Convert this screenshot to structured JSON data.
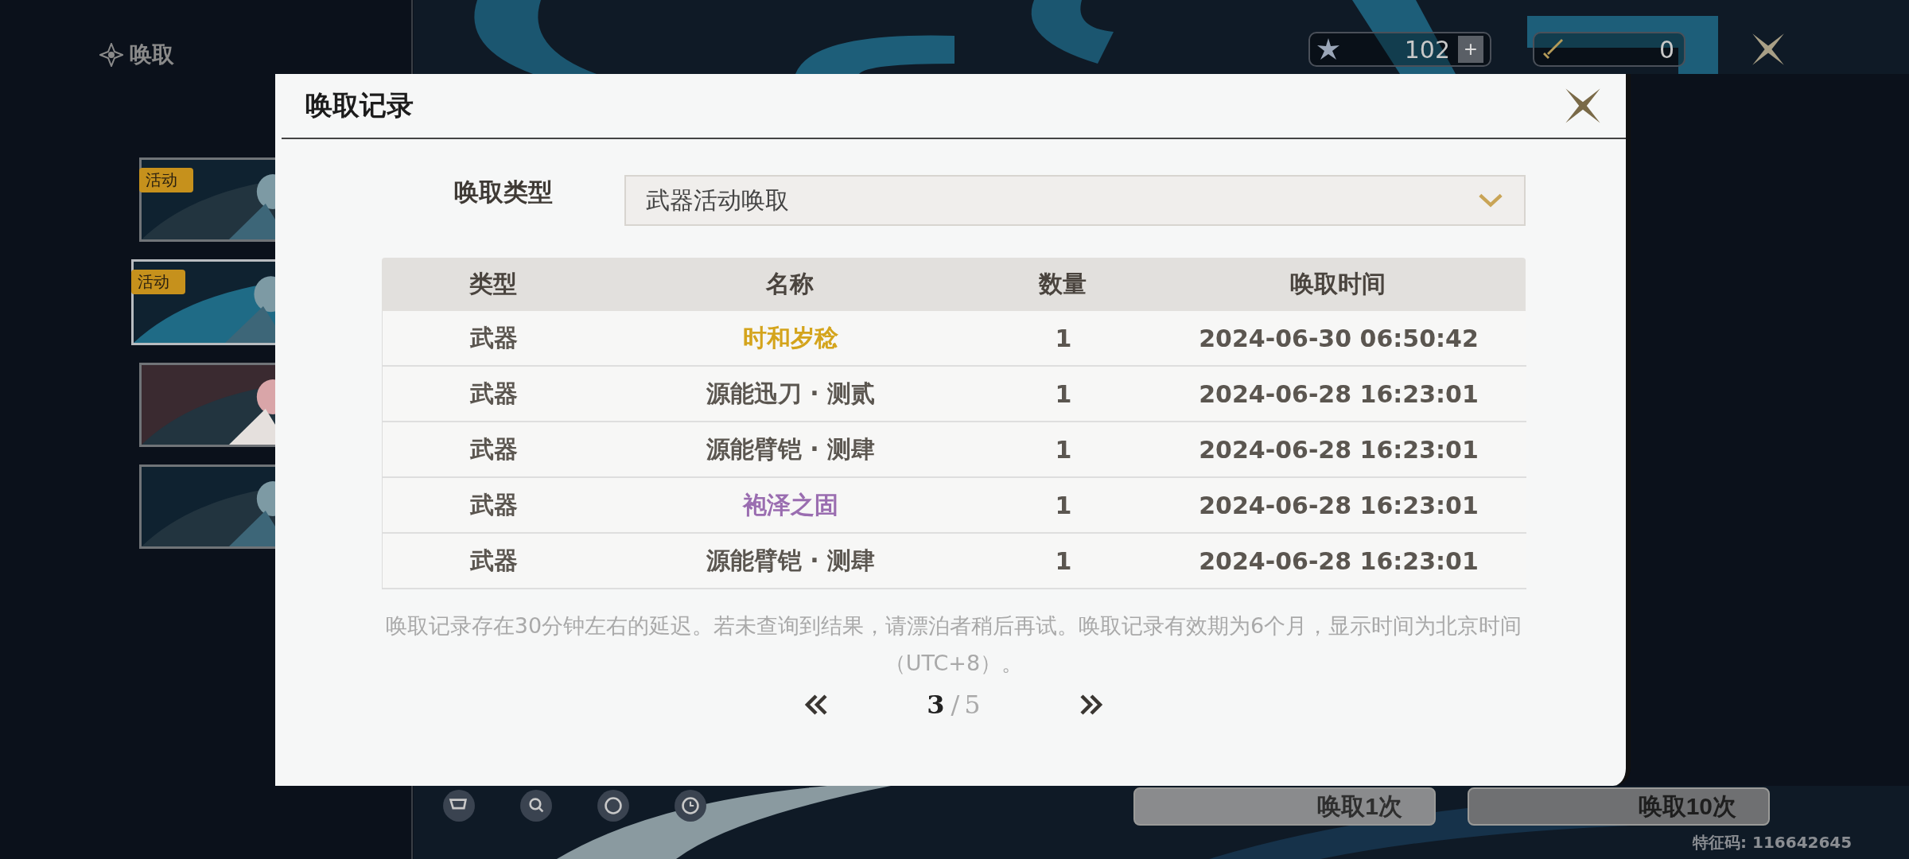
{
  "sidebar": {
    "title": "唤取",
    "banners": [
      {
        "tag": "活动",
        "selected": false
      },
      {
        "tag": "活动",
        "selected": true
      },
      {
        "selected": false
      },
      {
        "selected": false
      }
    ]
  },
  "currencies": [
    {
      "kind": "star",
      "amount": "102",
      "add": "+"
    },
    {
      "kind": "sword",
      "amount": "0"
    }
  ],
  "bottom_buttons": [
    {
      "label": "唤取1次",
      "dim": true
    },
    {
      "label": "唤取10次",
      "dim": false
    }
  ],
  "feature_code": "特征码: 116642645",
  "dialog": {
    "title": "唤取记录",
    "filter": {
      "label": "唤取类型",
      "value": "武器活动唤取"
    },
    "table": {
      "columns": [
        "类型",
        "名称",
        "数量",
        "唤取时间"
      ],
      "rows": [
        {
          "type": "武器",
          "name": "时和岁稔",
          "color": "#d4a41c",
          "count": "1",
          "time": "2024-06-30 06:50:42"
        },
        {
          "type": "武器",
          "name": "源能迅刀 · 测贰",
          "color": "#5b5650",
          "count": "1",
          "time": "2024-06-28 16:23:01"
        },
        {
          "type": "武器",
          "name": "源能臂铠 · 测肆",
          "color": "#5b5650",
          "count": "1",
          "time": "2024-06-28 16:23:01"
        },
        {
          "type": "武器",
          "name": "袍泽之固",
          "color": "#9a6db0",
          "count": "1",
          "time": "2024-06-28 16:23:01"
        },
        {
          "type": "武器",
          "name": "源能臂铠 · 测肆",
          "color": "#5b5650",
          "count": "1",
          "time": "2024-06-28 16:23:01"
        }
      ]
    },
    "note": "唤取记录存在30分钟左右的延迟。若未查询到结果，请漂泊者稍后再试。唤取记录有效期为6个月，显示时间为北京时间（UTC+8）。",
    "pagination": {
      "current": "3",
      "separator": "/",
      "total": "5"
    }
  }
}
